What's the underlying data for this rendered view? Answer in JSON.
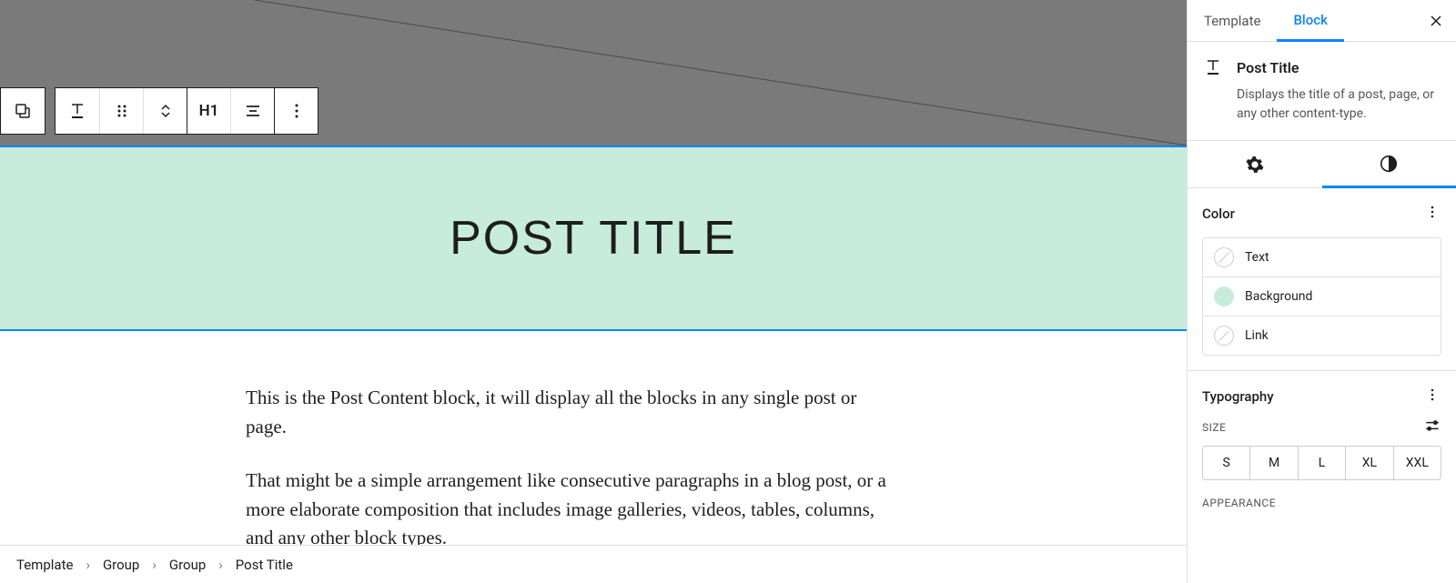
{
  "toolbar": {
    "heading_tag": "H1"
  },
  "editor": {
    "post_title": "POST TITLE",
    "paragraph_1": "This is the Post Content block, it will display all the blocks in any single post or page.",
    "paragraph_2": "That might be a simple arrangement like consecutive paragraphs in a blog post, or a more elaborate composition that includes image galleries, videos, tables, columns, and any other block types."
  },
  "breadcrumbs": [
    "Template",
    "Group",
    "Group",
    "Post Title"
  ],
  "sidebar": {
    "tabs": {
      "template": "Template",
      "block": "Block"
    },
    "block": {
      "name": "Post Title",
      "description": "Displays the title of a post, page, or any other content-type."
    },
    "panels": {
      "color": {
        "title": "Color",
        "rows": {
          "text": "Text",
          "background": "Background",
          "link": "Link"
        }
      },
      "typography": {
        "title": "Typography",
        "size_label": "SIZE",
        "sizes": [
          "S",
          "M",
          "L",
          "XL",
          "XXL"
        ],
        "appearance_label": "APPEARANCE"
      }
    }
  }
}
